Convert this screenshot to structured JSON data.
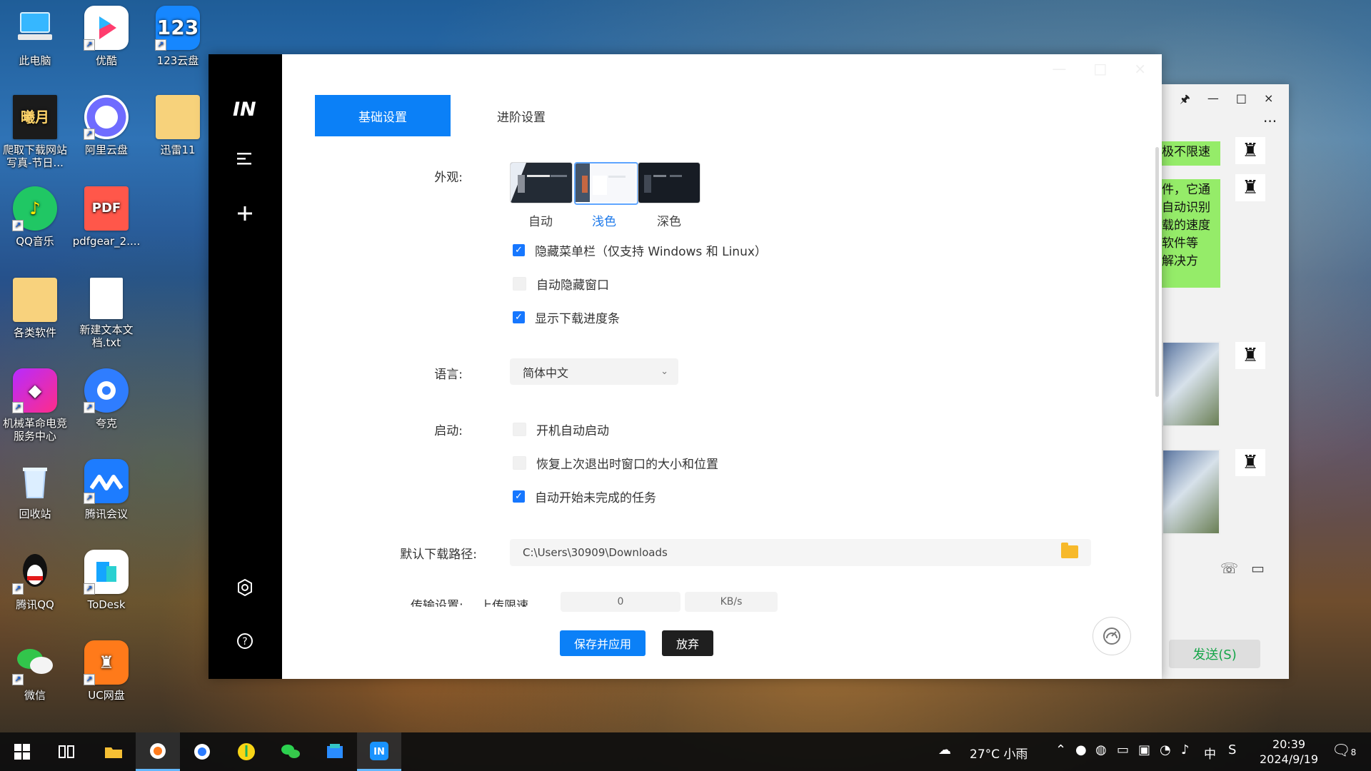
{
  "desktop": {
    "icons": [
      {
        "name": "pc",
        "label": "此电脑"
      },
      {
        "name": "youku",
        "label": "优酷"
      },
      {
        "name": "cloud123",
        "label": "123云盘",
        "tile_text": "123"
      },
      {
        "name": "crawler",
        "label": "爬取下载网站写真-节日...",
        "tile_text": "曦月"
      },
      {
        "name": "aliyun",
        "label": "阿里云盘"
      },
      {
        "name": "xunlei",
        "label": "迅雷11"
      },
      {
        "name": "qqmusic",
        "label": "QQ音乐"
      },
      {
        "name": "pdfgear",
        "label": "pdfgear_2....",
        "tile_text": "PDF"
      },
      {
        "name": "software",
        "label": "各类软件"
      },
      {
        "name": "newtxt",
        "label": "新建文本文档.txt"
      },
      {
        "name": "revolution",
        "label": "机械革命电竞服务中心"
      },
      {
        "name": "quark",
        "label": "夸克"
      },
      {
        "name": "recycle",
        "label": "回收站"
      },
      {
        "name": "tencent-meeting",
        "label": "腾讯会议"
      },
      {
        "name": "qq",
        "label": "腾讯QQ"
      },
      {
        "name": "todesk",
        "label": "ToDesk"
      },
      {
        "name": "wechat",
        "label": "微信"
      },
      {
        "name": "ucpan",
        "label": "UC网盘"
      }
    ]
  },
  "app": {
    "logo": "IN",
    "window_controls": [
      "—",
      "□",
      "×"
    ],
    "tabs": {
      "basic": "基础设置",
      "advanced": "进阶设置"
    },
    "appearance": {
      "label": "外观:",
      "themes": [
        {
          "caption": "自动"
        },
        {
          "caption": "浅色"
        },
        {
          "caption": "深色"
        }
      ]
    },
    "checkboxes": {
      "hide_menu": "隐藏菜单栏（仅支持 Windows 和 Linux）",
      "auto_hide": "自动隐藏窗口",
      "show_progress": "显示下载进度条",
      "auto_start": "开机自动启动",
      "restore_window": "恢复上次退出时窗口的大小和位置",
      "resume_tasks": "自动开始未完成的任务"
    },
    "language": {
      "label": "语言:",
      "value": "简体中文"
    },
    "startup": {
      "label": "启动:"
    },
    "download_path": {
      "label": "默认下载路径:",
      "value": "C:\\Users\\30909\\Downloads"
    },
    "transfer": {
      "label": "传输设置:",
      "upload_label": "上传限速",
      "upload_value": "0",
      "unit": "KB/s"
    },
    "buttons": {
      "save": "保存并应用",
      "discard": "放弃"
    }
  },
  "chat": {
    "controls": [
      "🖈",
      "—",
      "□",
      "×"
    ],
    "more": "···",
    "top_bubble_text": "极不限速",
    "bubble_lines": [
      "件，它通",
      "自动识别",
      "载的速度",
      "软件等",
      "解决方"
    ],
    "send": "发送(S)"
  },
  "taskbar": {
    "weather": "27°C 小雨",
    "ime": "中",
    "time": "20:39",
    "date": "2024/9/19",
    "notification_count": "8"
  }
}
